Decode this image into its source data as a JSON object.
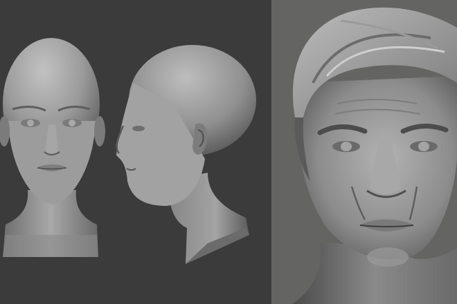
{
  "scene": {
    "colors": {
      "left_background": "#3b3b3b",
      "right_background": "#646462",
      "clay_light": "#b5b5b5",
      "clay_mid": "#8e8e8e",
      "clay_dark": "#4a4a4a"
    },
    "panels": [
      {
        "name": "female-head-sculpts",
        "views": [
          "front",
          "side"
        ]
      },
      {
        "name": "male-portrait-sculpt",
        "views": [
          "three-quarter"
        ]
      }
    ]
  }
}
